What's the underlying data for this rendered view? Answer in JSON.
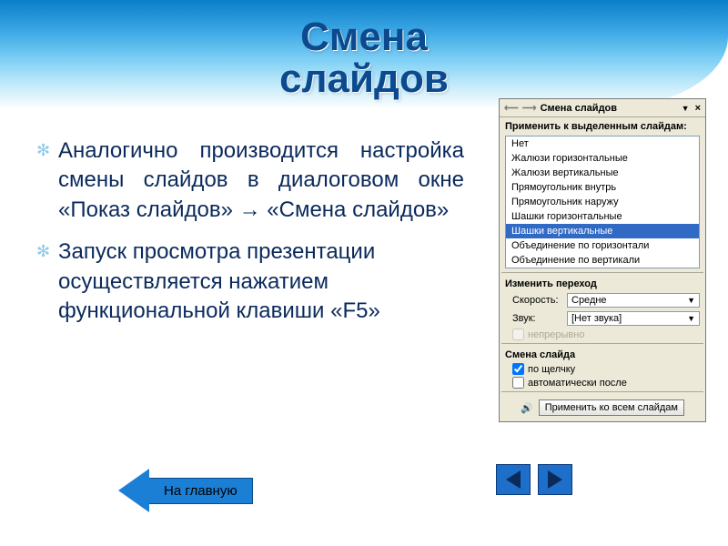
{
  "title_line1": "Смена",
  "title_line2": "слайдов",
  "bullets": [
    "Аналогично производится настройка смены слайдов в диалоговом окне «Показ слайдов» → «Смена слайдов»",
    "Запуск просмотра презентации осуществляется нажатием функциональной клавиши «F5»"
  ],
  "home_button": "На главную",
  "pane": {
    "title": "Смена слайдов",
    "apply_label": "Применить к выделенным слайдам:",
    "transitions": [
      "Нет",
      "Жалюзи горизонтальные",
      "Жалюзи вертикальные",
      "Прямоугольник внутрь",
      "Прямоугольник наружу",
      "Шашки горизонтальные",
      "Шашки вертикальные",
      "Объединение по горизонтали",
      "Объединение по вертикали"
    ],
    "selected_index": 6,
    "modify_label": "Изменить переход",
    "speed_label": "Скорость:",
    "speed_value": "Средне",
    "sound_label": "Звук:",
    "sound_value": "[Нет звука]",
    "loop_label": "непрерывно",
    "advance_label": "Смена слайда",
    "on_click": "по щелчку",
    "auto_after": "автоматически после",
    "apply_all": "Применить ко всем слайдам"
  }
}
